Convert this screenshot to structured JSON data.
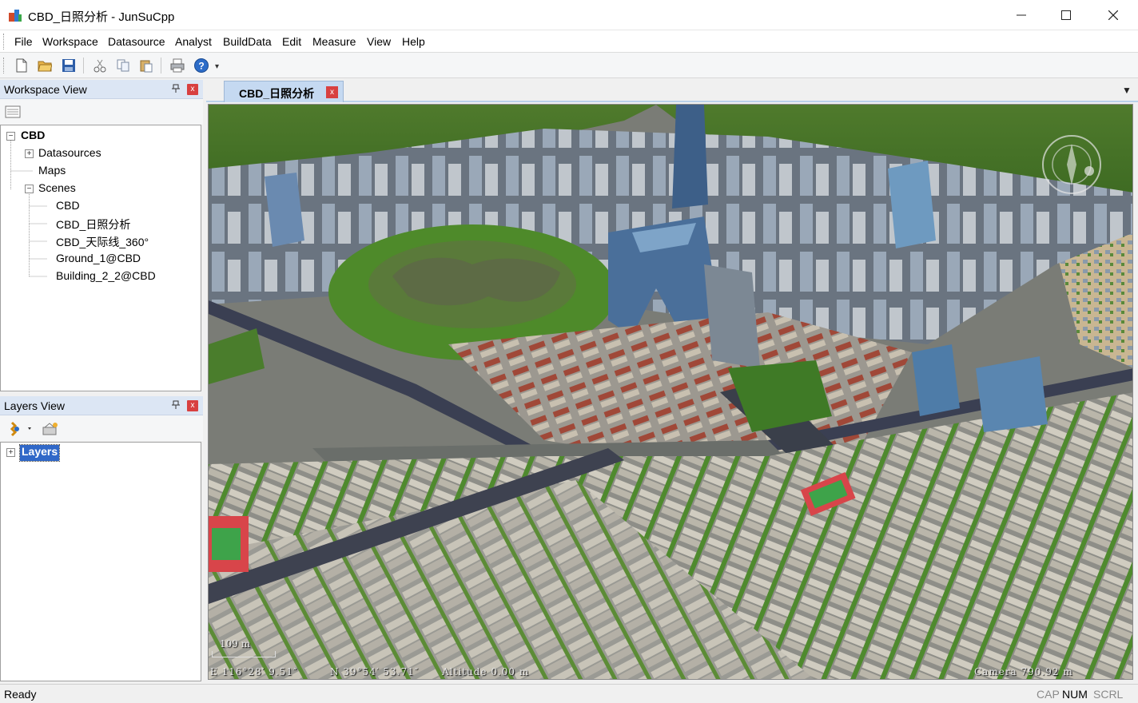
{
  "window": {
    "title": "CBD_日照分析 - JunSuCpp",
    "min_glyph": "—",
    "max_glyph": "☐",
    "close_glyph": "✕"
  },
  "menu": [
    "File",
    "Workspace",
    "Datasource",
    "Analyst",
    "BuildData",
    "Edit",
    "Measure",
    "View",
    "Help"
  ],
  "toolbar": {
    "icons": [
      "new-file-icon",
      "open-folder-icon",
      "save-icon",
      "cut-icon",
      "copy-icon",
      "paste-icon",
      "print-icon",
      "help-icon"
    ],
    "overflow_glyph": "▾"
  },
  "workspace_view": {
    "title": "Workspace View",
    "tree": {
      "root": "CBD",
      "datasources": "Datasources",
      "maps": "Maps",
      "scenes": "Scenes",
      "scene_items": [
        "CBD",
        "CBD_日照分析",
        "CBD_天际线_360°",
        "Ground_1@CBD",
        "Building_2_2@CBD"
      ]
    }
  },
  "layers_view": {
    "title": "Layers View",
    "tree": {
      "root": "Layers"
    }
  },
  "panel_buttons": {
    "pin_glyph": "📌",
    "close_glyph": "x"
  },
  "tab": {
    "label": "CBD_日照分析",
    "close_glyph": "x",
    "dropdown_glyph": "▼"
  },
  "scene_hud": {
    "scale": "109 m",
    "longitude": "E 116°28′ 9.51″",
    "latitude": "N 39°54′ 53.71″",
    "altitude": "Altitude 0.00 m",
    "camera": "Camera 790.92 m"
  },
  "status": {
    "text": "Ready",
    "cap": "CAP",
    "num": "NUM",
    "scrl": "SCRL"
  },
  "colors": {
    "tab_active": "#c5d9f1",
    "panel_header": "#dce6f4",
    "close_red": "#d84040"
  }
}
